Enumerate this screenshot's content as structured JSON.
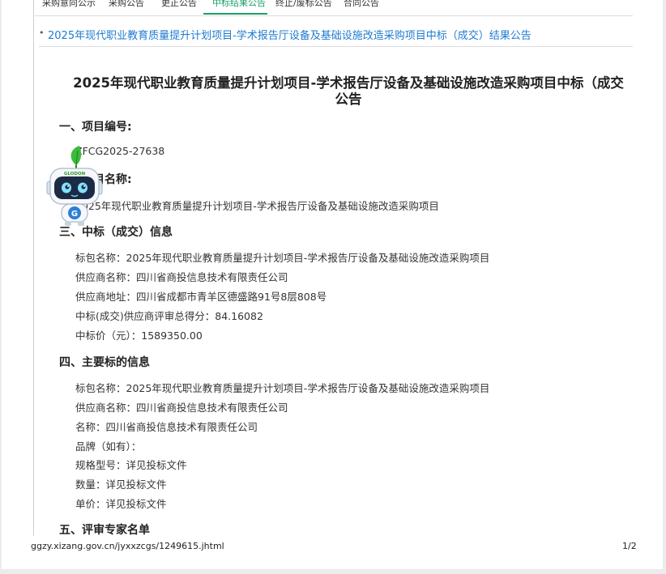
{
  "tabs": [
    {
      "label": "采购意向公示",
      "active": false
    },
    {
      "label": "采购公告",
      "active": false
    },
    {
      "label": "更正公告",
      "active": false
    },
    {
      "label": "中标结果公告",
      "active": true
    },
    {
      "label": "终止/废标公告",
      "active": false
    },
    {
      "label": "合同公告",
      "active": false
    }
  ],
  "result_link": "2025年现代职业教育质量提升计划项目-学术报告厅设备及基础设施改造采购项目中标（成交）结果公告",
  "doc_title_line1": "2025年现代职业教育质量提升计划项目-学术报告厅设备及基础设施改造采购项目中标（成交",
  "doc_title_line2": "公告",
  "section1": {
    "heading": "一、项目编号:",
    "value": "ZFCG2025-27638"
  },
  "section2": {
    "heading": "二、项目名称:",
    "value": "2025年现代职业教育质量提升计划项目-学术报告厅设备及基础设施改造采购项目"
  },
  "section3": {
    "heading": "三、中标（成交）信息",
    "lines": [
      "标包名称：2025年现代职业教育质量提升计划项目-学术报告厅设备及基础设施改造采购项目",
      "供应商名称：四川省商投信息技术有限责任公司",
      "供应商地址：四川省成都市青羊区德盛路91号8层808号",
      "中标(成交)供应商评审总得分：84.16082",
      "中标价（元）：1589350.00"
    ]
  },
  "section4": {
    "heading": "四、主要标的信息",
    "lines": [
      "标包名称：2025年现代职业教育质量提升计划项目-学术报告厅设备及基础设施改造采购项目",
      "供应商名称：四川省商投信息技术有限责任公司",
      "名称：四川省商投信息技术有限责任公司",
      "品牌（如有）：",
      "规格型号：详见投标文件",
      "数量：详见投标文件",
      "单价：详见投标文件"
    ]
  },
  "section5": {
    "heading": "五、评审专家名单"
  },
  "footer": {
    "url": "ggzy.xizang.gov.cn/jyxxzcgs/1249615.jhtml",
    "page": "1/2"
  },
  "mascot": {
    "brand": "GLODON",
    "badge": "G"
  },
  "colors": {
    "accent_green": "#1aa067",
    "link_blue": "#1e7bd1"
  }
}
